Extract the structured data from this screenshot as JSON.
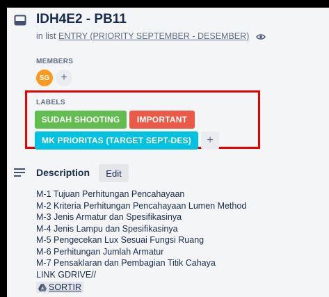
{
  "card": {
    "title": "IDH4E2 - PB11",
    "in_list_prefix": "in list",
    "list_name": "ENTRY (PRIORITY SEPTEMBER - DESEMBER)"
  },
  "members": {
    "heading": "MEMBERS",
    "avatar_initials": "SG",
    "add_symbol": "+"
  },
  "labels": {
    "heading": "LABELS",
    "items": [
      {
        "text": "SUDAH SHOOTING",
        "color": "#61bd4f"
      },
      {
        "text": "IMPORTANT",
        "color": "#eb5a46"
      },
      {
        "text": "MK PRIORITAS (TARGET SEPT-DES)",
        "color": "#00c2e0"
      }
    ],
    "add_symbol": "+",
    "highlight_color": "#eb0000"
  },
  "description": {
    "heading": "Description",
    "edit_label": "Edit",
    "lines": [
      "M-1 Tujuan Perhitungan Pencahayaan",
      "M-2 Kriteria Perhitungan Pencahayaan Lumen Method",
      "M-3 Jenis Armatur dan Spesifikasinya",
      "M-4 Jenis Lampu dan Spesifikasinya",
      "M-5 Pengecekan Lux Sesuai Fungsi Ruang",
      "M-6 Perhitungan Jumlah Armatur",
      "M-7 Pensaklaran dan Pembagian Titik Cahaya",
      "LINK GDRIVE//"
    ],
    "link_text": "SORTIR"
  },
  "icons": {
    "card": "card-icon",
    "watch": "eye-icon",
    "description": "description-icon",
    "drive": "google-drive-icon"
  }
}
